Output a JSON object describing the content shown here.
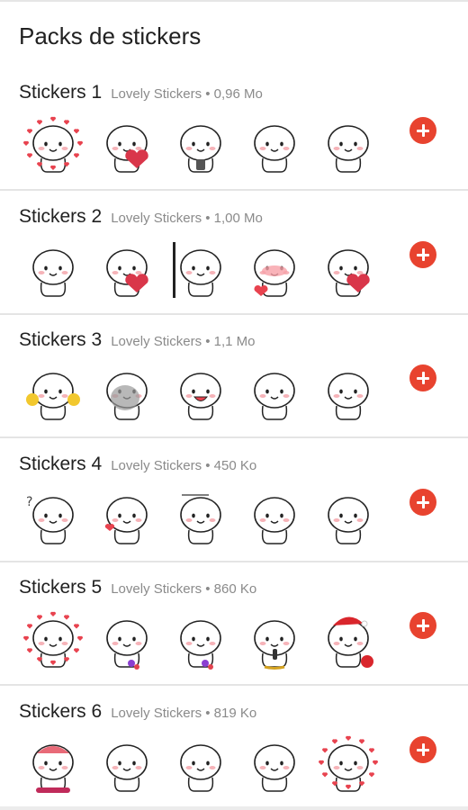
{
  "header": {
    "title": "Packs de stickers"
  },
  "packs": [
    {
      "name": "Stickers 1",
      "meta": "Lovely Stickers • 0,96 Mo",
      "stickers": [
        "hearts-wreath",
        "heart-hug",
        "phone",
        "wave",
        "smile"
      ]
    },
    {
      "name": "Stickers 2",
      "meta": "Lovely Stickers • 1,00 Mo",
      "stickers": [
        "smile",
        "heart-hold",
        "peek",
        "blush-heart",
        "heart-hold"
      ]
    },
    {
      "name": "Stickers 3",
      "meta": "Lovely Stickers • 1,1 Mo",
      "stickers": [
        "cheer",
        "sad-grey",
        "laugh",
        "sit",
        "point"
      ]
    },
    {
      "name": "Stickers 4",
      "meta": "Lovely Stickers • 450 Ko",
      "stickers": [
        "question",
        "kiss",
        "label",
        "happy",
        "wave"
      ]
    },
    {
      "name": "Stickers 5",
      "meta": "Lovely Stickers • 860 Ko",
      "stickers": [
        "hearts-wreath",
        "flower",
        "flower",
        "mic",
        "santa"
      ]
    },
    {
      "name": "Stickers 6",
      "meta": "Lovely Stickers • 819 Ko",
      "stickers": [
        "rider",
        "smile",
        "sit",
        "lie",
        "hearts-wreath"
      ]
    }
  ],
  "icons": {
    "add": "plus-circle-icon"
  },
  "colors": {
    "accent": "#e8432f",
    "title": "#212121",
    "meta": "#8a8a8a",
    "divider": "#e4e4e4"
  }
}
